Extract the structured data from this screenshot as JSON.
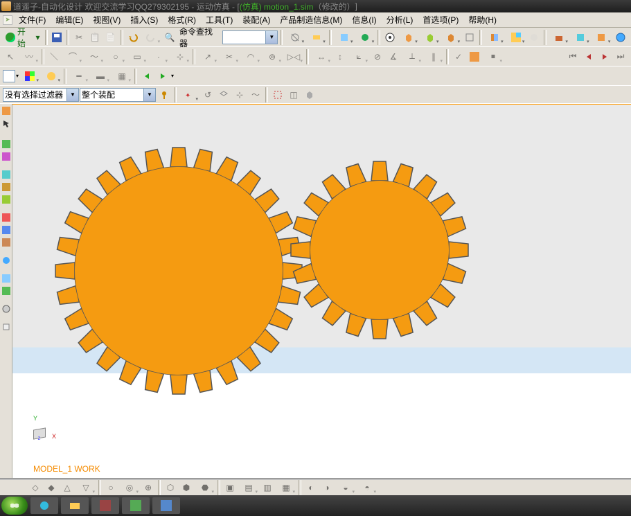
{
  "title": {
    "prefix": "道遥子-自动化设计 欢迎交流学习QQ279302195 - 运动仿真 - [",
    "doc": "(仿真) motion_1.sim",
    "suffix": "（修改的）",
    "close": "]"
  },
  "menu": {
    "file": "文件(F)",
    "edit": "编辑(E)",
    "view": "视图(V)",
    "insert": "插入(S)",
    "format": "格式(R)",
    "tools": "工具(T)",
    "assembly": "装配(A)",
    "pmi": "产品制造信息(M)",
    "info": "信息(I)",
    "analysis": "分析(L)",
    "prefs": "首选项(P)",
    "help": "帮助(H)"
  },
  "toolbar1": {
    "start": "开始",
    "cmdfinder": "命令查找器"
  },
  "filter": {
    "no_sel_filter": "没有选择过滤器",
    "whole_assembly": "整个装配"
  },
  "model_label": "MODEL_1 WORK",
  "axis": {
    "x": "X",
    "y": "Y",
    "z": "z"
  },
  "colors": {
    "gear": "#f59b11",
    "gear_stroke": "#5a5a5a"
  }
}
